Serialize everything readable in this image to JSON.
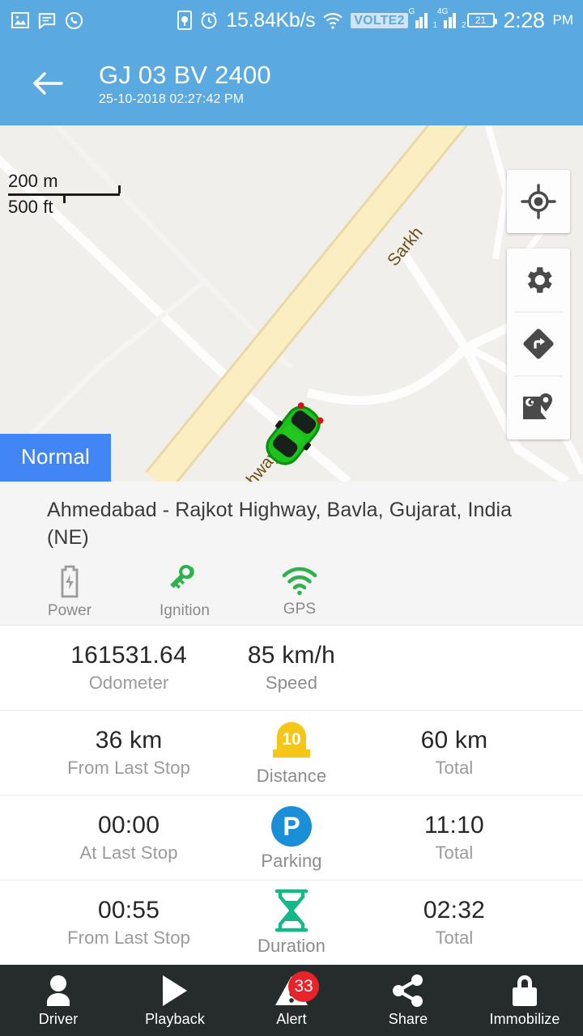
{
  "statusbar": {
    "left_icons": [
      "image-icon",
      "message-icon",
      "whatsapp-icon"
    ],
    "screenshot_icon": "screen-record-icon",
    "alarm_icon": "alarm-icon",
    "network_speed": "15.84Kb/s",
    "wifi_icon": "wifi-icon",
    "volte_label": "VOLTE2",
    "sim1_type": "G",
    "sim1_index": "1",
    "sim2_type": "4G",
    "sim2_index": "2",
    "battery_level": "21",
    "time": "2:28",
    "ampm": "PM"
  },
  "header": {
    "back_icon": "back-arrow-icon",
    "title": "GJ 03 BV 2400",
    "timestamp": "25-10-2018 02:27:42 PM",
    "bg_color": "#5aa9e0"
  },
  "map": {
    "scale_metric": "200 m",
    "scale_imperial": "500 ft",
    "road_label_main": "bad - Rajkot Highway",
    "road_label_top": "Sarkh",
    "vehicle_marker": "green-car-marker",
    "controls": [
      {
        "name": "my-location-icon",
        "label": "My Location"
      },
      {
        "name": "gear-icon",
        "label": "Settings"
      },
      {
        "name": "directions-icon",
        "label": "Directions"
      },
      {
        "name": "google-maps-icon",
        "label": "Open in Google Maps"
      }
    ],
    "status_badge": "Normal",
    "status_badge_color": "#4285f4"
  },
  "address": {
    "line1": "Ahmedabad - Rajkot Highway,  Bavla, Gujarat,",
    "line2": "India (NE)"
  },
  "device_status": [
    {
      "icon": "battery-bolt-icon",
      "label": "Power",
      "color": "#9b9b9b",
      "active": false
    },
    {
      "icon": "key-icon",
      "label": "Ignition",
      "color": "#2eb24d",
      "active": true
    },
    {
      "icon": "gps-signal-icon",
      "label": "GPS",
      "color": "#2eb24d",
      "active": true
    }
  ],
  "stats": [
    {
      "left_value": "161531.64",
      "left_label": "Odometer",
      "mid_icon": "",
      "mid_label": "",
      "right_value": "85 km/h",
      "right_label": "Speed",
      "two_col": true
    },
    {
      "left_value": "36 km",
      "left_label": "From Last Stop",
      "mid_icon": "milestone-icon",
      "mid_icon_text": "10",
      "mid_label": "Distance",
      "right_value": "60 km",
      "right_label": "Total",
      "two_col": false
    },
    {
      "left_value": "00:00",
      "left_label": "At Last Stop",
      "mid_icon": "parking-icon",
      "mid_icon_text": "P",
      "mid_label": "Parking",
      "right_value": "11:10",
      "right_label": "Total",
      "two_col": false
    },
    {
      "left_value": "00:55",
      "left_label": "From Last Stop",
      "mid_icon": "hourglass-icon",
      "mid_icon_text": "",
      "mid_label": "Duration",
      "right_value": "02:32",
      "right_label": "Total",
      "two_col": false
    }
  ],
  "bottom_nav": [
    {
      "icon": "person-icon",
      "label": "Driver",
      "badge": ""
    },
    {
      "icon": "play-icon",
      "label": "Playback",
      "badge": ""
    },
    {
      "icon": "warning-icon",
      "label": "Alert",
      "badge": "33"
    },
    {
      "icon": "share-icon",
      "label": "Share",
      "badge": ""
    },
    {
      "icon": "lock-icon",
      "label": "Immobilize",
      "badge": ""
    }
  ],
  "colors": {
    "accent": "#5aa9e0",
    "badge_blue": "#4285f4",
    "alert_red": "#e8232a",
    "green": "#2eb24d",
    "teal": "#14b98a",
    "yellow": "#f5c518",
    "nav_bg": "#262b2b"
  }
}
